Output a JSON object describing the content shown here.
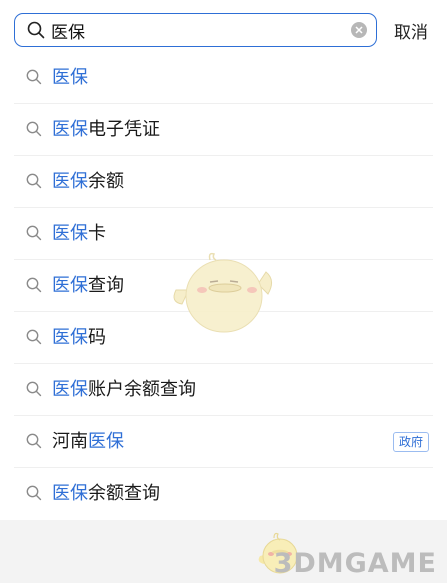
{
  "search": {
    "value": "医保",
    "cancel_label": "取消"
  },
  "suggestions": [
    {
      "highlight": "医保",
      "rest": "",
      "badge": ""
    },
    {
      "highlight": "医保",
      "rest": "电子凭证",
      "badge": ""
    },
    {
      "highlight": "医保",
      "rest": "余额",
      "badge": ""
    },
    {
      "highlight": "医保",
      "rest": "卡",
      "badge": ""
    },
    {
      "highlight": "医保",
      "rest": "查询",
      "badge": ""
    },
    {
      "highlight": "医保",
      "rest": "码",
      "badge": ""
    },
    {
      "highlight": "医保",
      "rest": "账户余额查询",
      "badge": ""
    },
    {
      "prefix": "河南",
      "highlight": "医保",
      "rest": "",
      "badge": "政府"
    },
    {
      "highlight": "医保",
      "rest": "余额查询",
      "badge": ""
    }
  ],
  "watermark": {
    "text": "3DMGAME"
  },
  "colors": {
    "accent": "#2f6fd6",
    "border": "#2e6fd6",
    "divider": "#efefef",
    "bottom_bg": "#f3f3f3"
  }
}
